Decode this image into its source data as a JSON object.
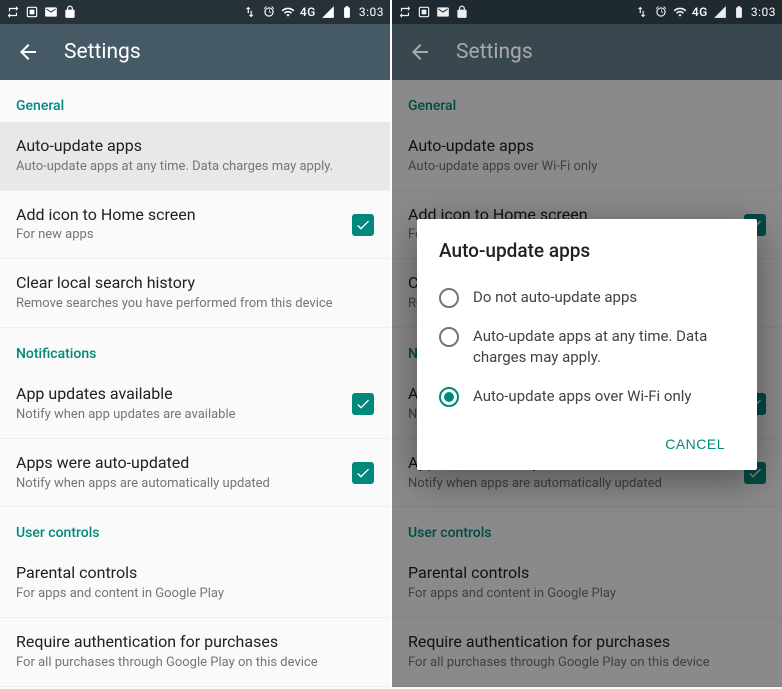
{
  "status": {
    "left_icons": [
      "retweet",
      "app-box",
      "gmail",
      "lock"
    ],
    "right_icons": [
      "updown",
      "alarm",
      "wifi"
    ],
    "network": "4G",
    "signal": "signal",
    "battery": "battery",
    "time": "3:03"
  },
  "appbar": {
    "title": "Settings"
  },
  "screen1": {
    "sections": {
      "general": {
        "header": "General",
        "auto_update": {
          "title": "Auto-update apps",
          "sub": "Auto-update apps at any time. Data charges may apply."
        },
        "add_icon": {
          "title": "Add icon to Home screen",
          "sub": "For new apps",
          "checked": true
        },
        "clear_search": {
          "title": "Clear local search history",
          "sub": "Remove searches you have performed from this device"
        }
      },
      "notifications": {
        "header": "Notifications",
        "updates_available": {
          "title": "App updates available",
          "sub": "Notify when app updates are available",
          "checked": true
        },
        "auto_updated": {
          "title": "Apps were auto-updated",
          "sub": "Notify when apps are automatically updated",
          "checked": true
        }
      },
      "user_controls": {
        "header": "User controls",
        "parental": {
          "title": "Parental controls",
          "sub": "For apps and content in Google Play"
        },
        "require_auth": {
          "title": "Require authentication for purchases",
          "sub": "For all purchases through Google Play on this device"
        }
      }
    }
  },
  "screen2": {
    "auto_update_sub": "Auto-update apps over Wi-Fi only",
    "dialog": {
      "title": "Auto-update apps",
      "options": [
        {
          "label": "Do not auto-update apps",
          "selected": false
        },
        {
          "label": "Auto-update apps at any time. Data charges may apply.",
          "selected": false
        },
        {
          "label": "Auto-update apps over Wi-Fi only",
          "selected": true
        }
      ],
      "cancel": "CANCEL"
    }
  }
}
